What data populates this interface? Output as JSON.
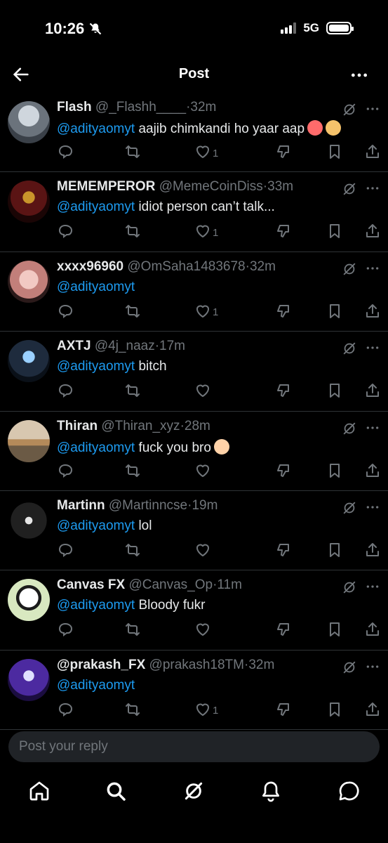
{
  "status": {
    "time": "10:26",
    "network": "5G"
  },
  "header": {
    "title": "Post"
  },
  "replies": [
    {
      "name": "Flash",
      "handle": "@_Flashh____",
      "ago": "32m",
      "mention": "@adityaomyt",
      "text": "aajib chimkandi ho yaar aap",
      "emoji": [
        "clown-emoji",
        "folded-hands-emoji"
      ],
      "likes": "1"
    },
    {
      "name": "MEMEMPEROR",
      "handle": "@MemeCoinDiss",
      "ago": "33m",
      "mention": "@adityaomyt",
      "text": "idiot person can’t talk...",
      "emoji": [],
      "likes": "1"
    },
    {
      "name": "xxxx96960",
      "handle": "@OmSaha1483678",
      "ago": "32m",
      "mention": "@adityaomyt",
      "text": "",
      "emoji": [],
      "likes": "1"
    },
    {
      "name": "AXTJ",
      "handle": "@4j_naaz",
      "ago": "17m",
      "mention": "@adityaomyt",
      "text": "bitch",
      "emoji": [],
      "likes": ""
    },
    {
      "name": "Thiran",
      "handle": "@Thiran_xyz",
      "ago": "28m",
      "mention": "@adityaomyt",
      "text": "fuck you bro",
      "emoji": [
        "middle-finger-emoji"
      ],
      "likes": ""
    },
    {
      "name": "Martinn",
      "handle": "@Martinncse",
      "ago": "19m",
      "mention": "@adityaomyt",
      "text": "lol",
      "emoji": [],
      "likes": ""
    },
    {
      "name": "Canvas FX",
      "handle": "@Canvas_Op",
      "ago": "11m",
      "mention": "@adityaomyt",
      "text": "Bloody fukr",
      "emoji": [],
      "likes": ""
    },
    {
      "name": "@prakash_FX",
      "handle": "@prakash18TM",
      "ago": "32m",
      "mention": "@adityaomyt",
      "text": "",
      "emoji": [],
      "likes": "1"
    }
  ],
  "composer": {
    "placeholder": "Post your reply"
  },
  "tabs": [
    "home-icon",
    "search-icon",
    "grok-icon",
    "notifications-icon",
    "messages-icon"
  ],
  "colors": {
    "accent": "#1d9bf0",
    "muted": "#71767b",
    "divider": "#2f3336"
  }
}
